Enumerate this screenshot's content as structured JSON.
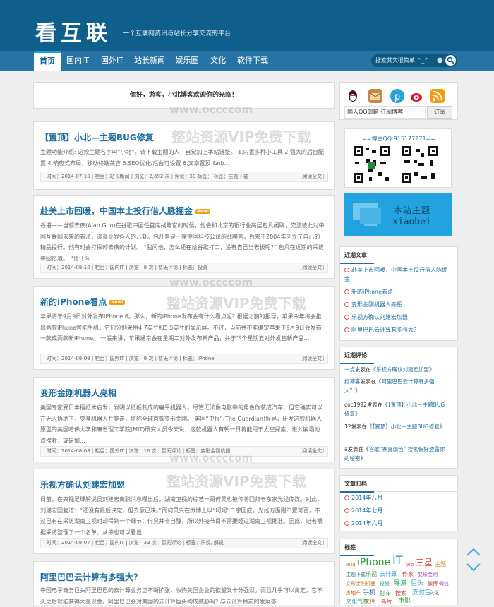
{
  "header": {
    "logo": "看互联",
    "slogan": "一个互联网资讯与站长分享交流的平台"
  },
  "nav": {
    "items": [
      "首页",
      "国内IT",
      "国外IT",
      "站长新闻",
      "娱乐圈",
      "文化",
      "软件下载"
    ],
    "active": 0
  },
  "search": {
    "placeholder": "搜索其实很简单 ^_^"
  },
  "welcome": "你好，游客，小北博客欢迎你的光临！",
  "watermarks": {
    "site": "www.occccom",
    "resource": "整站资源VIP免费下载"
  },
  "posts": [
    {
      "title": "【置顶】小北—主题BUG修复",
      "new": false,
      "excerpt": "主题功能介绍: 这款主题名字叫“小北”。请下载主题的人，自觉加上本站链接。 1.内置多种小工具 2.强大的后台配置 4.响应式布局，移动终端兼容 5.SEO优化/后台可设置 6.文章置顶 &nb...",
      "date": "时间：2014-07-10",
      "cat": "栏目：站长新闻",
      "views": "浏览：2,692 次",
      "comments": "评论：30",
      "tags": "标签：主题下载",
      "full": "[阅读全文]"
    },
    {
      "title": "赴美上市回暖，中国本土投行借人脉掘金",
      "new": true,
      "excerpt": "香港——当郭去疾(Alan Guo)在谷歌中国任首席战略官的时候，他会和北京的银行业高层包凡闲聊，交流彼此对中国互联网未来的看法，谈谈业界各人的八卦。包凡曾是一家中国科技公司的战略官，后来于2004年创立了自己的精品投行。他有时会打探郭去疾的计划。 “我问他，怎么还在给谷歌打工，没有自己当老板呢?” 包凡在近期的采访中回忆道。 “他什么...",
      "date": "时间：2014-08-10",
      "cat": "栏目：国内IT",
      "views": "浏览：8 次",
      "comments": "暂无评论",
      "tags": "标签：投资",
      "full": "[阅读全文]"
    },
    {
      "title": "新的iPhone看点",
      "new": true,
      "excerpt": "苹果将于9月9日对外发布iPhone 6。那么，新的iPhone发布会有什么看点呢? 根据之前的报导，苹果今年将会推出两款iPhone智能手机，它们分别采用4.7英寸和5.5英寸的显示屏。不过，当前并不能确定苹果于9月9日会发布一款或两款新iPhone。 一般来讲，苹果通常会在星期二对外发布新产品，并于下个星期五对外发售新产品...",
      "date": "时间：2014-08-09",
      "cat": "栏目：国外IT",
      "views": "浏览：9 次",
      "comments": "暂无评论",
      "tags": "标签：iPhone",
      "full": "[阅读全文]"
    },
    {
      "title": "变形金刚机器人亮相",
      "new": false,
      "excerpt": "美国专家受日本摺纸术启发，发明以纸板制成的扁平机器人。尽管无法像电影中的角色伪装成汽车，但它确实可以在无人协助下，变身机器人并爬走，堪称全球首款变形金刚。 英国“卫报”(The Guardian)报导，研发这款机器人原型的美国哈佛大学和麻省理工学院(MIT)研究人员今天说，这款机器人有朝一日将能用于太空探索、进入崩塌地点搜救，或是加...",
      "date": "时间：2014-08-08",
      "cat": "栏目：国外IT",
      "views": "浏览：16 次",
      "comments": "暂无评论",
      "tags": "标签：变形金刚机器",
      "full": "[阅读全文]"
    },
    {
      "title": "乐视方确认刘建宏加盟",
      "new": false,
      "excerpt": "日前，在央视足球解说员刘建宏离职消息曝出后，湖南卫视的综艺一哥何炅也被传将回归老东家光线传媒。对此，刘建宏回复道：“还没有最后决定，但去意已决。”而何炅只在微博上以“呵呵”二字回应，光线方面则不置可否，不过已有在采访湖南卫视时却得到一个细节：何炅并非自醇，所以外接节目不需要经过湖南卫视批准。因此，记者根据采访整理了一个名单，从中也可以看出...",
      "date": "时间：2014-08-07",
      "cat": "栏目：国内IT",
      "views": "浏览：33 次",
      "comments": "暂无评论",
      "tags": "标签：乐视, 解说",
      "full": "[阅读全文]"
    },
    {
      "title": "阿里巴巴云计算有多强大？",
      "new": false,
      "excerpt": "中国电子商务巨头阿里巴巴的云计算业务正不断扩张，收购美国企业的欲望又十分强烈。而且几乎可以肯定，它不久之后就能获得大量现金。阿里巴巴会对美国的云计算巨头构成威胁吗? 与云计算目前的发展态..."
    }
  ],
  "sidebar": {
    "subscribe": {
      "placeholder": "输入QQ邮箱 订阅博客",
      "button": "订阅"
    },
    "qq": "==博主QQ:915177271==",
    "theme_banner": {
      "line1": "本站主题",
      "line2": "xiaobei"
    },
    "recent_posts": {
      "title": "近期文章",
      "items": [
        "赴美上市回暖，中国本土投行借人脉掘金",
        "新的iPhone看点",
        "变形金刚机器人亮相",
        "乐视方确认刘建宏加盟",
        "阿里巴巴云计算有多强大？"
      ]
    },
    "recent_comments": {
      "title": "近期评论",
      "items": [
        {
          "author": "一点",
          "mid": "发表在《",
          "link": "乐视方确认刘建宏加盟",
          "end": "》"
        },
        {
          "author": "红博客",
          "mid": "发表在《",
          "link": "阿里巴巴云计算有多强大？",
          "end": "》"
        },
        {
          "author": "coc1992",
          "mid": "发表在《",
          "link": "【置顶】小北—主题BUG修复",
          "end": "》"
        },
        {
          "author": "12发",
          "mid": "表在《",
          "link": "【置顶】小北—主题BUG修复",
          "end": "》"
        },
        {
          "author": "a",
          "mid": "发表在《",
          "link": "谷歌“寨喜观色” 搜索偏好透露你的秘密",
          "end": "》"
        }
      ]
    },
    "archives": {
      "title": "文章归档",
      "items": [
        "2014年八月",
        "2014年七月",
        "2014年六月"
      ]
    },
    "tags": {
      "title": "标签",
      "items": [
        "Bug",
        "iPhone",
        "IT",
        "wp",
        "三星",
        "主题",
        "主题下载",
        "乐视",
        "云计算",
        "作家",
        "变形金刚",
        "变形金刚机器",
        "投资",
        "导演",
        "巨头",
        "微博",
        "微信",
        "房地产",
        "手机",
        "打车",
        "搜索",
        "支付宝",
        "文化",
        "文化气息",
        "文件",
        "新片",
        "电影"
      ]
    }
  },
  "colors": {
    "header": "#0f5f8c",
    "nav": "#2774a4",
    "link": "#1f6fa3",
    "accent": "#17a1d8"
  }
}
